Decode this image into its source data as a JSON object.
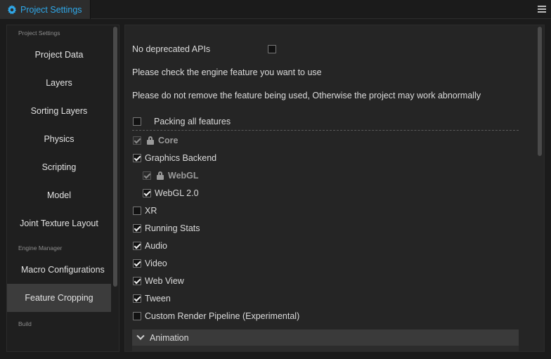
{
  "tab": {
    "title": "Project Settings",
    "icon": "gear-icon"
  },
  "colors": {
    "accent": "#2fa8e9",
    "background": "#1b1b1b",
    "panel": "#252525",
    "active_item": "#3c3c3c"
  },
  "sidebar": {
    "groups": [
      {
        "label": "Project Settings",
        "items": [
          "Project Data",
          "Layers",
          "Sorting Layers",
          "Physics",
          "Scripting",
          "Model",
          "Joint Texture Layout"
        ]
      },
      {
        "label": "Engine Manager",
        "items": [
          "Macro Configurations",
          "Feature Cropping"
        ]
      },
      {
        "label": "Build",
        "items": []
      }
    ],
    "active": "Feature Cropping"
  },
  "main": {
    "no_deprecated_label": "No deprecated APIs",
    "no_deprecated_checked": false,
    "hint1": "Please check the engine feature you want to use",
    "hint2": "Please do not remove the feature being used, Otherwise the project may work abnormally",
    "packing_all_label": "Packing all features",
    "packing_all_checked": false,
    "features": [
      {
        "label": "Core",
        "checked": true,
        "locked": true,
        "level": 0
      },
      {
        "label": "Graphics Backend",
        "checked": true,
        "locked": false,
        "level": 0
      },
      {
        "label": "WebGL",
        "checked": true,
        "locked": true,
        "level": 1
      },
      {
        "label": "WebGL 2.0",
        "checked": true,
        "locked": false,
        "level": 1
      },
      {
        "label": "XR",
        "checked": false,
        "locked": false,
        "level": 0
      },
      {
        "label": "Running Stats",
        "checked": true,
        "locked": false,
        "level": 0
      },
      {
        "label": "Audio",
        "checked": true,
        "locked": false,
        "level": 0
      },
      {
        "label": "Video",
        "checked": true,
        "locked": false,
        "level": 0
      },
      {
        "label": "Web View",
        "checked": true,
        "locked": false,
        "level": 0
      },
      {
        "label": "Tween",
        "checked": true,
        "locked": false,
        "level": 0
      },
      {
        "label": "Custom Render Pipeline (Experimental)",
        "checked": false,
        "locked": false,
        "level": 0
      }
    ],
    "section_label": "Animation",
    "section_icon": "chevron-down-icon"
  }
}
